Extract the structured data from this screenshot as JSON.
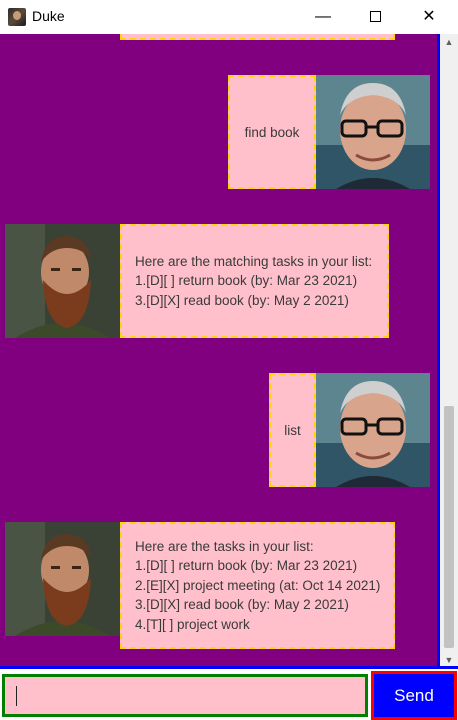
{
  "window": {
    "title": "Duke",
    "minimize_glyph": "—",
    "close_glyph": "✕"
  },
  "icons": [
    "app-icon",
    "minimize-icon",
    "maximize-icon",
    "close-icon",
    "scroll-up-arrow-icon",
    "scroll-down-arrow-icon"
  ],
  "colors": {
    "chat_background": "#800080",
    "bubble_fill": "#ffc0cb",
    "bubble_border": "#ffd700",
    "input_fill": "#ffc0cb",
    "input_border": "#008000",
    "send_fill": "#0000ff",
    "send_border": "#ff0000",
    "edge_accent": "#0000ff"
  },
  "messages": [
    {
      "sender": "user",
      "lines": [
        "find book"
      ]
    },
    {
      "sender": "duke",
      "lines": [
        "Here are the matching tasks in your list:",
        "1.[D][ ] return book (by: Mar 23 2021)",
        "3.[D][X] read book (by: May 2 2021)"
      ]
    },
    {
      "sender": "user",
      "lines": [
        "list"
      ]
    },
    {
      "sender": "duke",
      "lines": [
        "Here are the tasks in your list:",
        "1.[D][ ] return book (by: Mar 23 2021)",
        "2.[E][X] project meeting (at: Oct 14 2021)",
        "3.[D][X] read book (by: May 2 2021)",
        "4.[T][ ] project work"
      ]
    }
  ],
  "input": {
    "value": ""
  },
  "send_button": {
    "label": "Send"
  },
  "scrollbar": {
    "up_glyph": "▲",
    "down_glyph": "▼"
  }
}
